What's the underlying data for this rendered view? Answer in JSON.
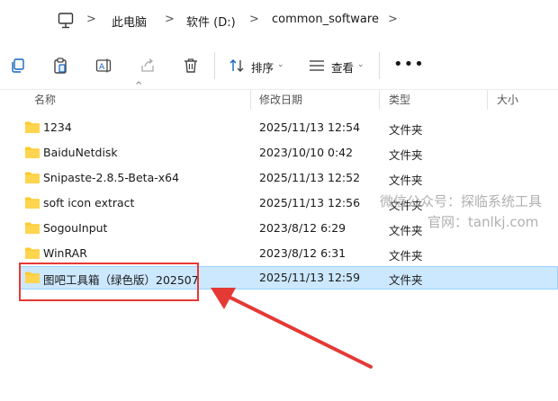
{
  "address": {
    "path": [
      "此电脑",
      "软件 (D:)",
      "common_software"
    ],
    "chevron": ">"
  },
  "toolbar": {
    "sort_label": "排序",
    "view_label": "查看",
    "more_label": "•••",
    "caret": "⌄"
  },
  "columns": {
    "name": "名称",
    "modified": "修改日期",
    "type": "类型",
    "size": "大小",
    "sort_caret": "^"
  },
  "files": [
    {
      "name": "1234",
      "modified": "2025/11/13 12:54",
      "type": "文件夹"
    },
    {
      "name": "BaiduNetdisk",
      "modified": "2023/10/10 0:42",
      "type": "文件夹"
    },
    {
      "name": "Snipaste-2.8.5-Beta-x64",
      "modified": "2025/11/13 12:52",
      "type": "文件夹"
    },
    {
      "name": "soft icon extract",
      "modified": "2025/11/13 12:56",
      "type": "文件夹"
    },
    {
      "name": "SogouInput",
      "modified": "2023/8/12 6:29",
      "type": "文件夹"
    },
    {
      "name": "WinRAR",
      "modified": "2023/8/12 6:31",
      "type": "文件夹"
    },
    {
      "name": "图吧工具箱（绿色版）202507",
      "modified": "2025/11/13 12:59",
      "type": "文件夹",
      "selected": true
    }
  ],
  "watermark": {
    "line1": "微信公众号：探临系统工具",
    "line2": "官网：tanlkj.com"
  },
  "colors": {
    "selection_bg": "#cce8ff",
    "selection_border": "#99d1ff",
    "folder": "#ffca28",
    "annotation": "#e53935"
  },
  "icons": [
    "computer-icon",
    "copy-icon",
    "paste-icon",
    "rename-icon",
    "share-icon",
    "delete-icon",
    "sort-icon",
    "view-icon",
    "folder-icon"
  ]
}
